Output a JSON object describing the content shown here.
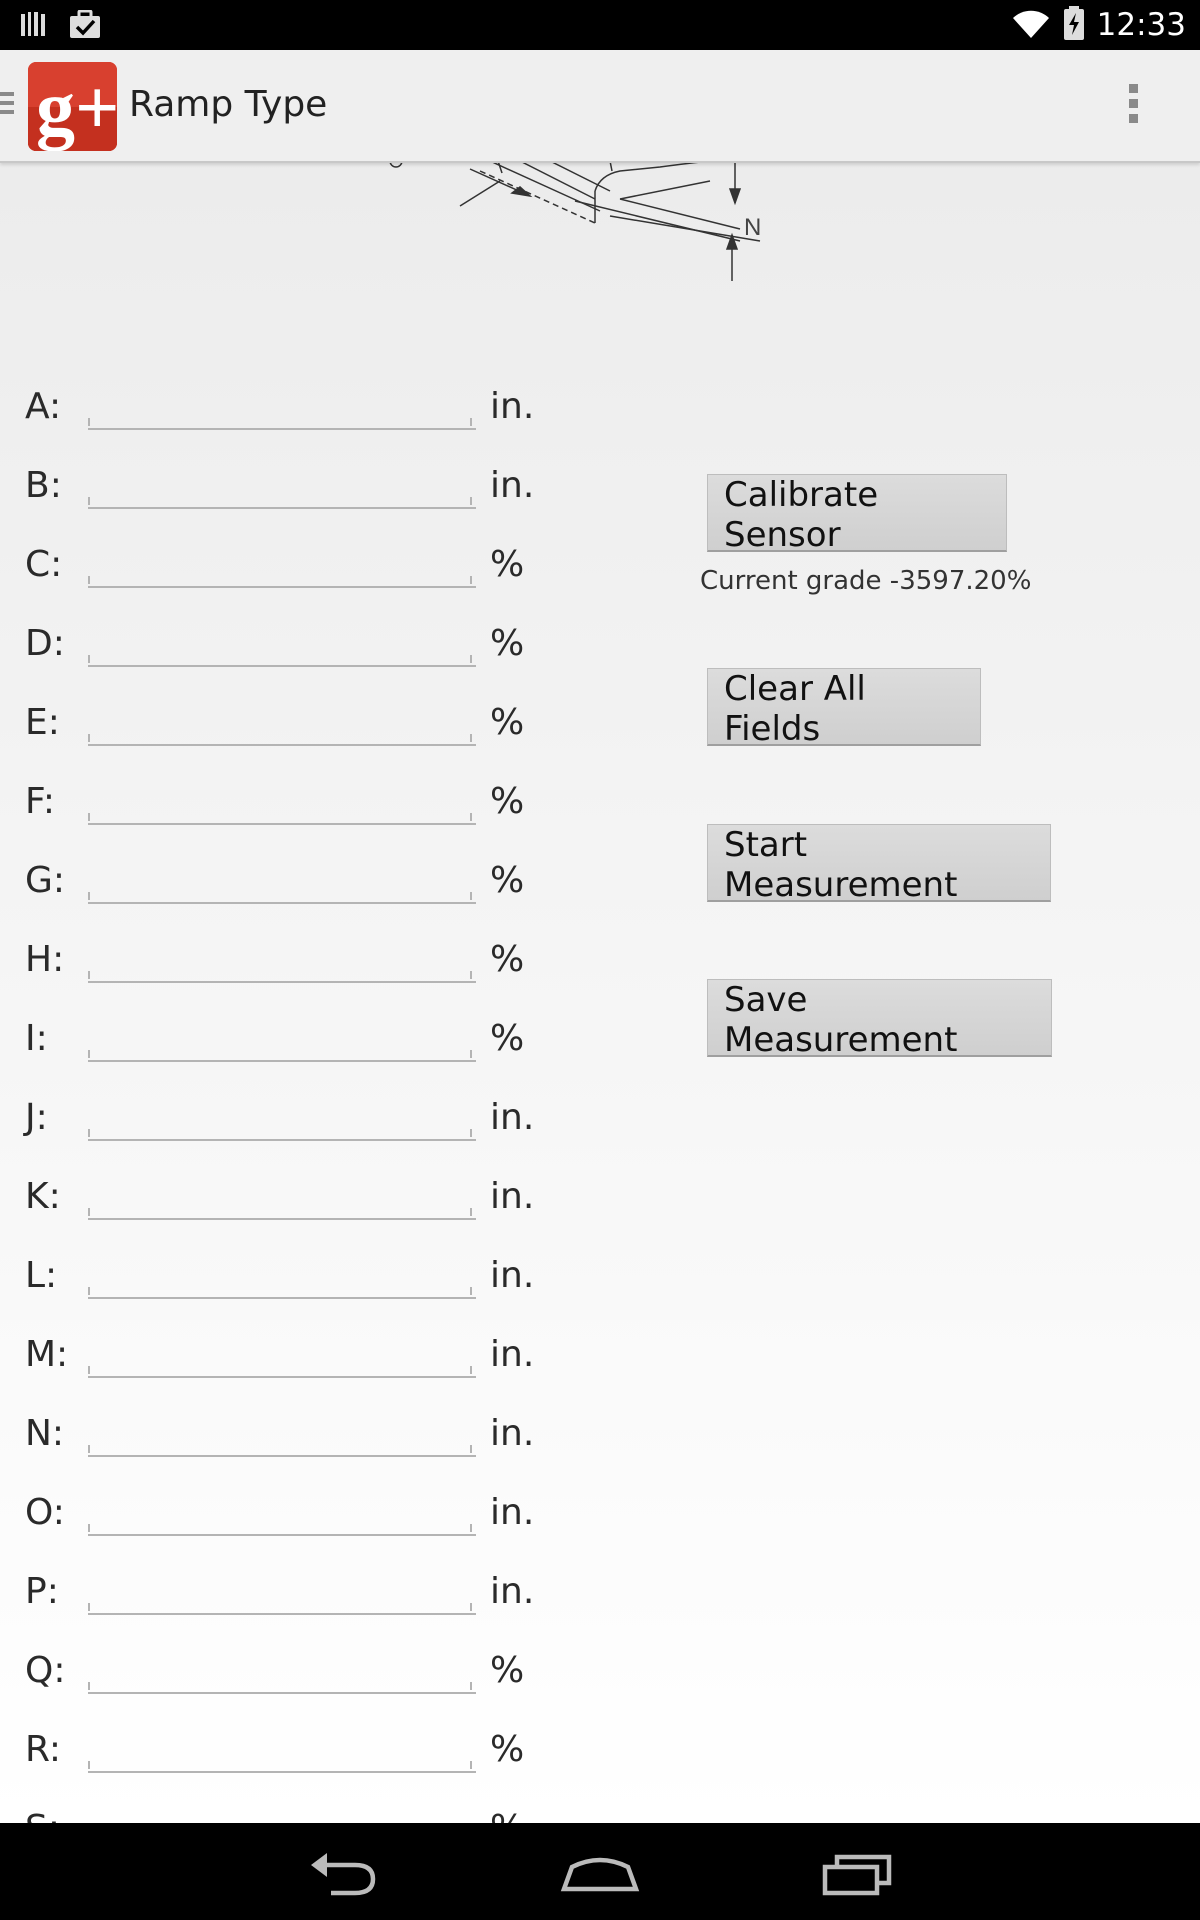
{
  "status_bar": {
    "time": "12:33",
    "left_icons": [
      "barcode-icon",
      "task-check-icon"
    ],
    "right_icons": [
      "wifi-icon",
      "battery-charging-icon"
    ]
  },
  "action_bar": {
    "title": "Ramp Type",
    "app_icon": "google-plus-icon",
    "logo_text": "g+",
    "overflow_icon": "overflow-menu-icon"
  },
  "diagram": {
    "label": "N"
  },
  "fields": [
    {
      "label": "A:",
      "unit": "in.",
      "value": ""
    },
    {
      "label": "B:",
      "unit": "in.",
      "value": ""
    },
    {
      "label": "C:",
      "unit": "%",
      "value": ""
    },
    {
      "label": "D:",
      "unit": "%",
      "value": ""
    },
    {
      "label": "E:",
      "unit": "%",
      "value": ""
    },
    {
      "label": "F:",
      "unit": "%",
      "value": ""
    },
    {
      "label": "G:",
      "unit": "%",
      "value": ""
    },
    {
      "label": "H:",
      "unit": "%",
      "value": ""
    },
    {
      "label": "I:",
      "unit": "%",
      "value": ""
    },
    {
      "label": "J:",
      "unit": "in.",
      "value": ""
    },
    {
      "label": "K:",
      "unit": "in.",
      "value": ""
    },
    {
      "label": "L:",
      "unit": "in.",
      "value": ""
    },
    {
      "label": "M:",
      "unit": "in.",
      "value": ""
    },
    {
      "label": "N:",
      "unit": "in.",
      "value": ""
    },
    {
      "label": "O:",
      "unit": "in.",
      "value": ""
    },
    {
      "label": "P:",
      "unit": "in.",
      "value": ""
    },
    {
      "label": "Q:",
      "unit": "%",
      "value": ""
    },
    {
      "label": "R:",
      "unit": "%",
      "value": ""
    },
    {
      "label": "S:",
      "unit": "%",
      "value": ""
    }
  ],
  "buttons": {
    "calibrate": "Calibrate Sensor",
    "clear": "Clear All Fields",
    "start": "Start Measurement",
    "save": "Save Measurement"
  },
  "current_grade": "Current grade -3597.20%",
  "nav_bar": {
    "back_icon": "back-icon",
    "home_icon": "home-icon",
    "recents_icon": "recent-apps-icon"
  },
  "colors": {
    "logo_red": "#d8402f",
    "button_bg": "#d6d6d6"
  }
}
